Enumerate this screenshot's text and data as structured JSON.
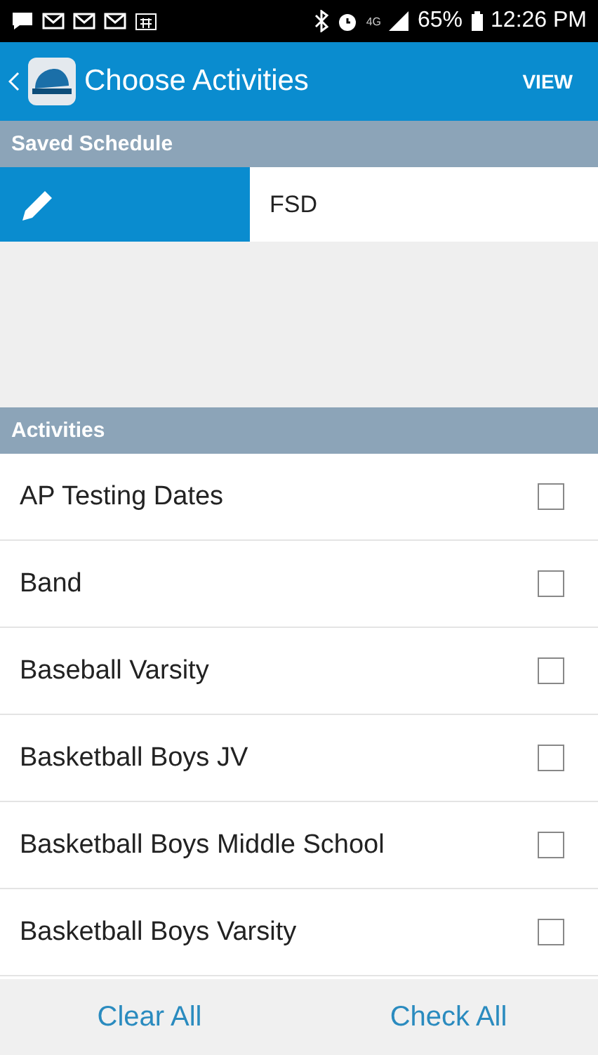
{
  "status_bar": {
    "network": "4G",
    "battery": "65%",
    "time": "12:26 PM"
  },
  "app_bar": {
    "title": "Choose Activities",
    "action": "VIEW"
  },
  "saved_schedule": {
    "header": "Saved Schedule",
    "value": "FSD"
  },
  "activities": {
    "header": "Activities",
    "items": [
      {
        "label": "AP Testing Dates",
        "checked": false
      },
      {
        "label": "Band",
        "checked": false
      },
      {
        "label": "Baseball Varsity",
        "checked": false
      },
      {
        "label": "Basketball Boys JV",
        "checked": false
      },
      {
        "label": "Basketball Boys Middle School",
        "checked": false
      },
      {
        "label": "Basketball Boys Varsity",
        "checked": false
      }
    ]
  },
  "footer": {
    "buttons": [
      "Clear All",
      "Check All"
    ]
  }
}
